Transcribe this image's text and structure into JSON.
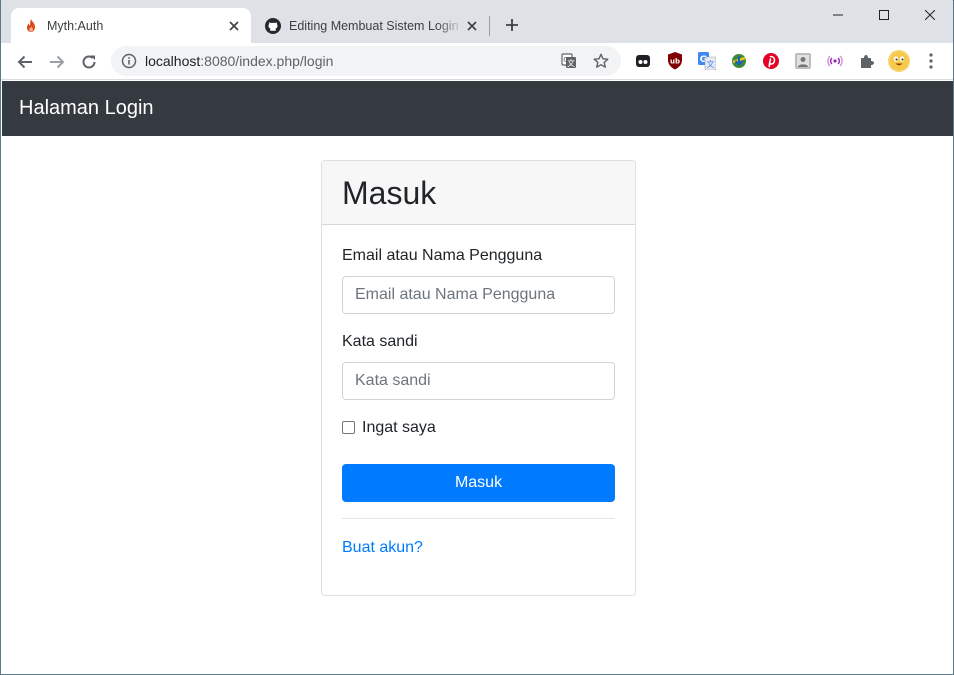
{
  "browser": {
    "tabs": [
      {
        "title": "Myth:Auth",
        "icon": "flame-icon",
        "active": true
      },
      {
        "title": "Editing Membuat Sistem Login de",
        "icon": "github-icon",
        "active": false
      }
    ],
    "address": {
      "host": "localhost",
      "rest": ":8080/index.php/login"
    },
    "extensions": [
      "tab-extension-icon",
      "ublock-icon",
      "google-translate-icon",
      "idm-icon",
      "pinterest-icon",
      "image-extension-icon",
      "broadcast-icon",
      "puzzle-icon"
    ],
    "profile_icon": "emoji-profile-icon"
  },
  "navbar": {
    "brand": "Halaman Login"
  },
  "login": {
    "title": "Masuk",
    "login_label": "Email atau Nama Pengguna",
    "login_placeholder": "Email atau Nama Pengguna",
    "password_label": "Kata sandi",
    "password_placeholder": "Kata sandi",
    "remember_label": "Ingat saya",
    "submit_label": "Masuk",
    "register_link": "Buat akun?"
  },
  "colors": {
    "navbar_bg": "#343a40",
    "primary": "#007bff",
    "tabstrip_bg": "#dee1e6"
  }
}
